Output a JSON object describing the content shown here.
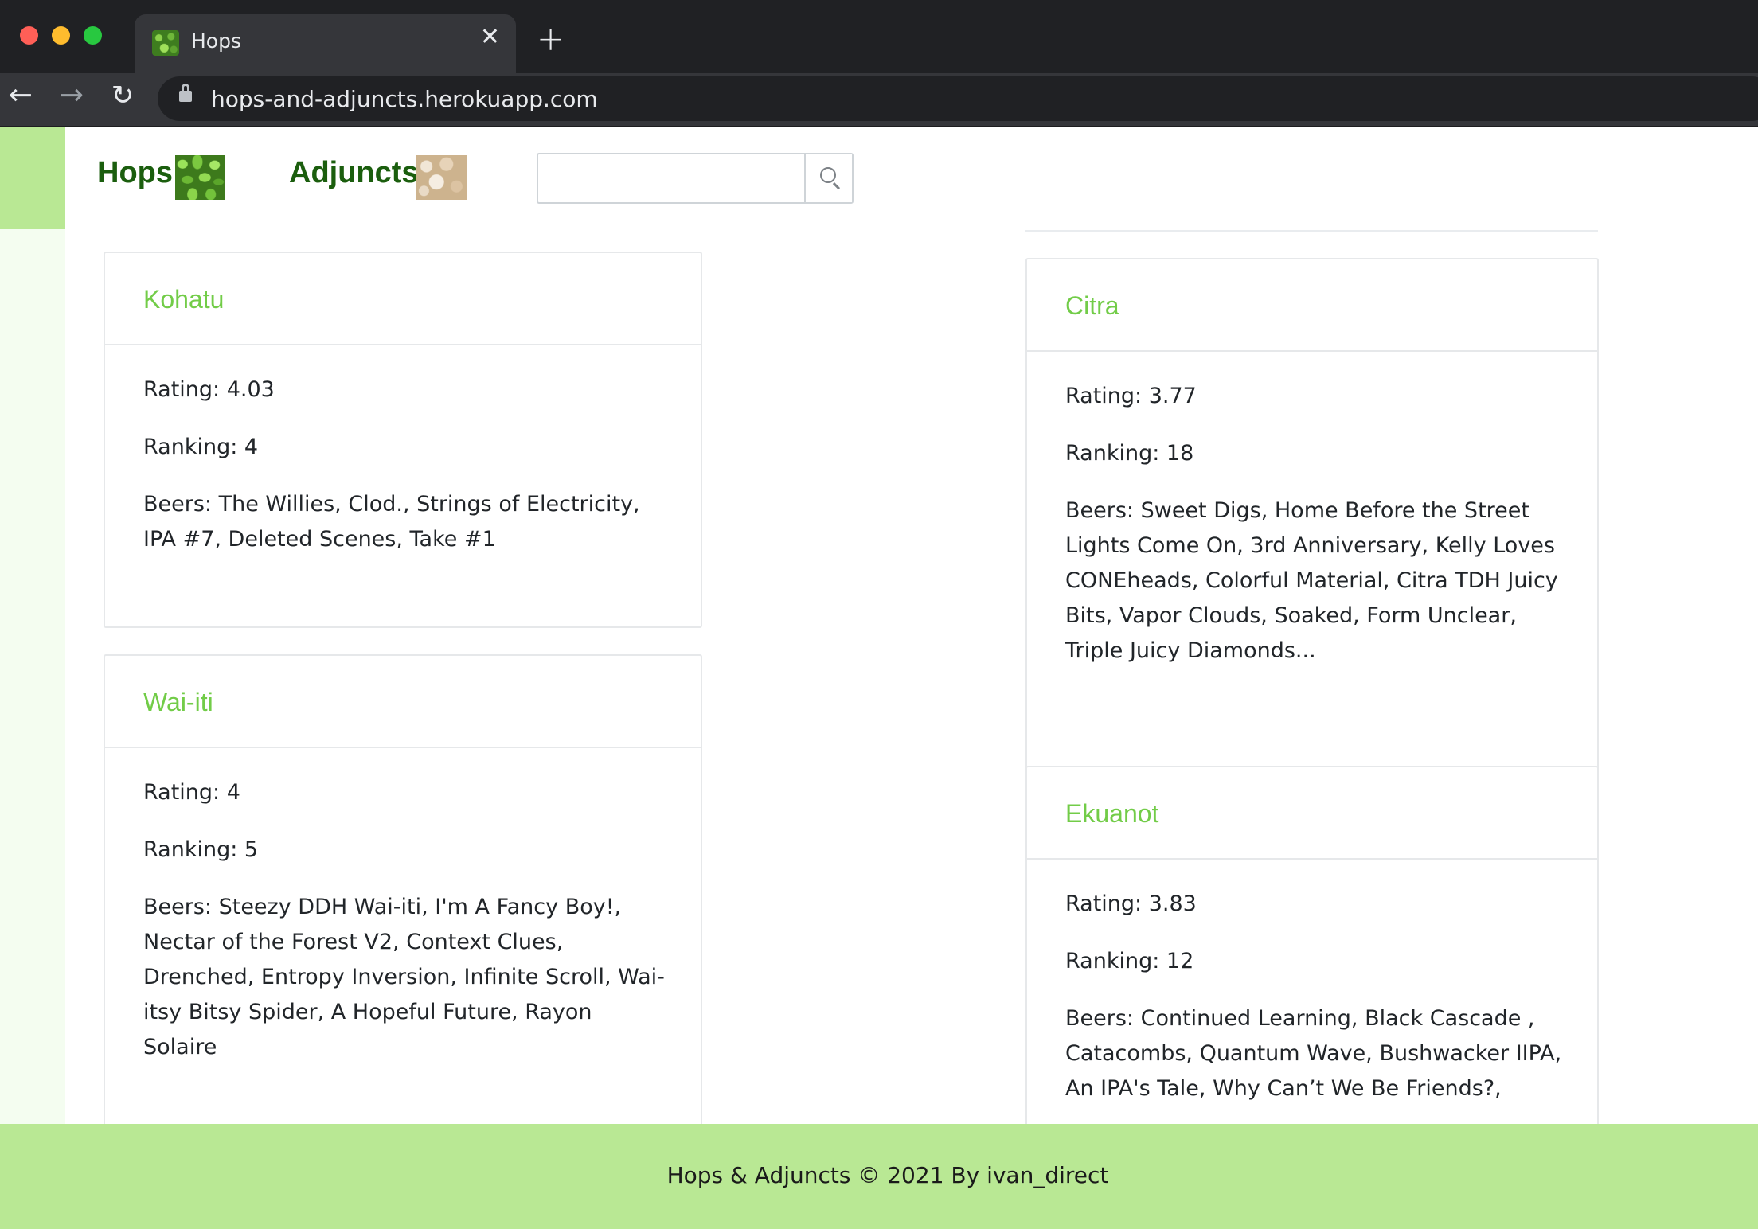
{
  "browser": {
    "tab_title": "Hops",
    "tab_close": "✕",
    "new_tab": "+",
    "url": "hops-and-adjuncts.herokuapp.com",
    "back": "←",
    "forward": "→",
    "reload": "↻"
  },
  "nav": {
    "hops_label": "Hops",
    "adjuncts_label": "Adjuncts",
    "search_placeholder": ""
  },
  "cards": [
    {
      "name": "Kohatu",
      "rating": "Rating: 4.03",
      "ranking": "Ranking: 4",
      "beers": "Beers: The Willies, Clod., Strings of Electricity, IPA #7, Deleted Scenes, Take #1"
    },
    {
      "name": "Wai-iti",
      "rating": "Rating: 4",
      "ranking": "Ranking: 5",
      "beers": "Beers: Steezy DDH Wai-iti, I'm A Fancy Boy!, Nectar of the Forest V2, Context Clues, Drenched, Entropy Inversion, Infinite Scroll, Wai-itsy Bitsy Spider, A Hopeful Future, Rayon Solaire"
    },
    {
      "name": "Citra",
      "rating": "Rating: 3.77",
      "ranking": "Ranking: 18",
      "beers": "Beers: Sweet Digs, Home Before the Street Lights Come On, 3rd Anniversary, Kelly Loves CONEheads, Colorful Material, Citra TDH Juicy Bits, Vapor Clouds, Soaked, Form Unclear, Triple Juicy Diamonds..."
    },
    {
      "name": "Ekuanot",
      "rating": "Rating: 3.83",
      "ranking": "Ranking: 12",
      "beers": "Beers: Continued Learning, Black Cascade , Catacombs, Quantum Wave, Bushwacker IIPA, An IPA's Tale, Why Can’t We Be Friends?,"
    }
  ],
  "footer": {
    "text": "Hops & Adjuncts © 2021 By ivan_direct"
  },
  "colors": {
    "accent_green": "#b9e894",
    "title_green": "#72cc48",
    "brand_green": "#1b5e0e"
  }
}
